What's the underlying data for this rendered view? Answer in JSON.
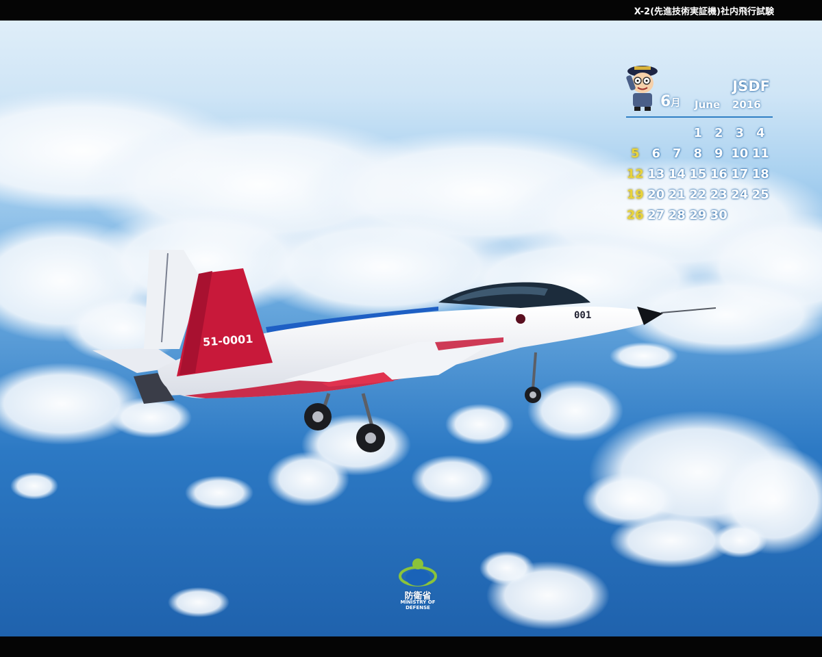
{
  "header": {
    "title": "X-2(先進技術実証機)社内飛行試験"
  },
  "calendar": {
    "brand": "JSDF",
    "month_num": "6",
    "month_kanji": "月",
    "month_name": "June",
    "year": "2016",
    "weeks": [
      [
        "",
        "",
        "",
        "1",
        "2",
        "3",
        "4"
      ],
      [
        "5",
        "6",
        "7",
        "8",
        "9",
        "10",
        "11"
      ],
      [
        "12",
        "13",
        "14",
        "15",
        "16",
        "17",
        "18"
      ],
      [
        "19",
        "20",
        "21",
        "22",
        "23",
        "24",
        "25"
      ],
      [
        "26",
        "27",
        "28",
        "29",
        "30",
        "",
        ""
      ]
    ],
    "sunday_color": "#e8d33a"
  },
  "aircraft": {
    "tail_number": "51-0001",
    "nose_number": "001"
  },
  "logo": {
    "kanji": "防衛省",
    "english_line1": "MINISTRY OF",
    "english_line2": "DEFENSE"
  },
  "colors": {
    "sky_top": "#dfeef9",
    "sky_bottom": "#1f62ad",
    "accent_red": "#c8193a",
    "accent_blue": "#1e5fc4"
  }
}
